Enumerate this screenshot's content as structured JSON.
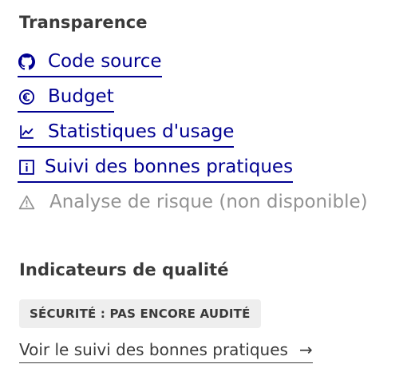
{
  "colors": {
    "link": "#000091",
    "text": "#3a3a3a",
    "disabled": "#929292",
    "badge_bg": "#eeeeee"
  },
  "transparence": {
    "title": "Transparence",
    "links": [
      {
        "label": "Code source",
        "icon": "github-icon"
      },
      {
        "label": "Budget",
        "icon": "euro-icon"
      },
      {
        "label": "Statistiques d'usage",
        "icon": "line-chart-icon"
      },
      {
        "label": "Suivi des bonnes pratiques",
        "icon": "info-icon"
      }
    ],
    "disabled_item": {
      "label": "Analyse de risque (non disponible)",
      "icon": "warning-icon"
    }
  },
  "qualite": {
    "title": "Indicateurs de qualité",
    "badge": "Sécurité : Pas encore audité",
    "link_label": "Voir le suivi des bonnes pratiques",
    "link_arrow": "→"
  }
}
